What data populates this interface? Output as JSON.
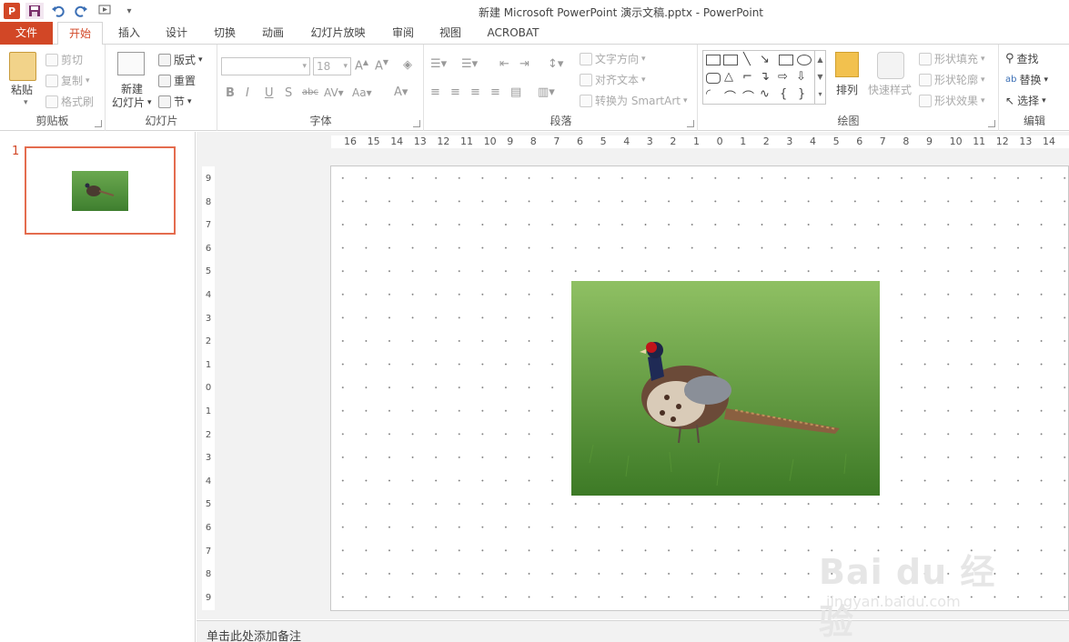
{
  "window": {
    "title": "新建 Microsoft PowerPoint 演示文稿.pptx - PowerPoint",
    "ppt_icon": "P"
  },
  "tabs": [
    "文件",
    "开始",
    "插入",
    "设计",
    "切换",
    "动画",
    "幻灯片放映",
    "审阅",
    "视图",
    "ACROBAT"
  ],
  "ribbon": {
    "clipboard": {
      "label": "剪贴板",
      "paste": "粘贴",
      "cut": "剪切",
      "copy": "复制",
      "format_painter": "格式刷"
    },
    "slides": {
      "label": "幻灯片",
      "new_slide": "新建",
      "new_slide2": "幻灯片",
      "layout": "版式",
      "reset": "重置",
      "section": "节"
    },
    "font": {
      "label": "字体",
      "size": "18"
    },
    "paragraph": {
      "label": "段落",
      "text_direction": "文字方向",
      "align_text": "对齐文本",
      "smartart": "转换为 SmartArt"
    },
    "drawing": {
      "label": "绘图",
      "arrange": "排列",
      "quick_styles": "快速样式",
      "shape_fill": "形状填充",
      "shape_outline": "形状轮廓",
      "shape_effects": "形状效果"
    },
    "editing": {
      "label": "编辑",
      "find": "查找",
      "replace": "替换",
      "select": "选择"
    }
  },
  "thumbnails": [
    {
      "number": "1"
    }
  ],
  "ruler": {
    "horizontal": [
      "16",
      "15",
      "14",
      "13",
      "12",
      "11",
      "10",
      "9",
      "8",
      "7",
      "6",
      "5",
      "4",
      "3",
      "2",
      "1",
      "0",
      "1",
      "2",
      "3",
      "4",
      "5",
      "6",
      "7",
      "8",
      "9",
      "10",
      "11",
      "12",
      "13",
      "14"
    ],
    "vertical": [
      "9",
      "8",
      "7",
      "6",
      "5",
      "4",
      "3",
      "2",
      "1",
      "0",
      "1",
      "2",
      "3",
      "4",
      "5",
      "6",
      "7",
      "8",
      "9"
    ]
  },
  "notes": {
    "placeholder": "单击此处添加备注"
  },
  "watermark": {
    "logo": "Bai du 经验",
    "url": "jingyan.baidu.com"
  },
  "colors": {
    "accent": "#d24726",
    "selection_border": "#e46c4e"
  }
}
